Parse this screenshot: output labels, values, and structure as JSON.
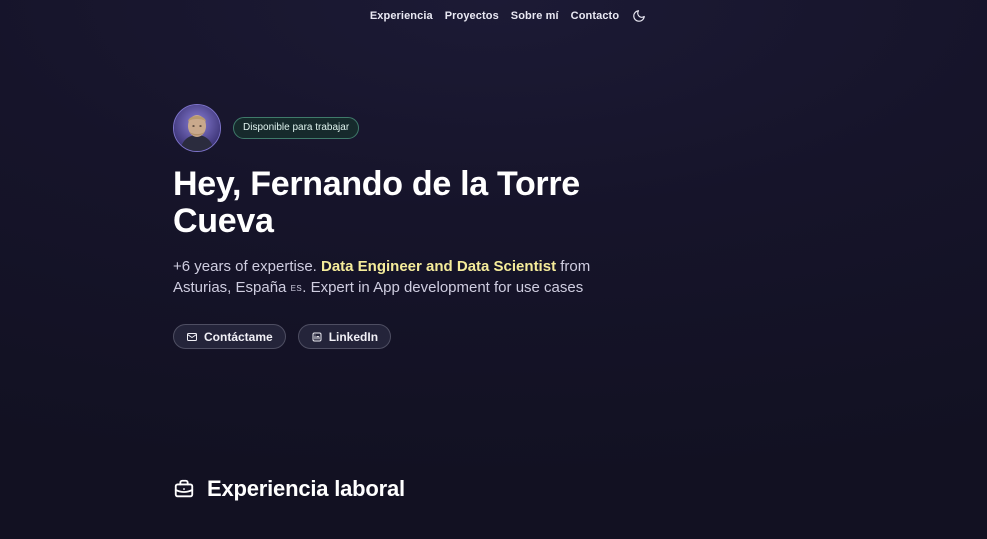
{
  "nav": {
    "items": [
      {
        "label": "Experiencia"
      },
      {
        "label": "Proyectos"
      },
      {
        "label": "Sobre mí"
      },
      {
        "label": "Contacto"
      }
    ],
    "theme_icon": "moon-icon"
  },
  "hero": {
    "avatar_icon": "profile-photo",
    "badge": "Disponible para trabajar",
    "title": "Hey, Fernando de la Torre Cueva",
    "desc_prefix": "+6 years of expertise. ",
    "desc_highlight": "Data Engineer and Data Scientist",
    "desc_middle": " from Asturias, España ",
    "desc_flag": "ES",
    "desc_suffix": ". Expert in App development for use cases",
    "buttons": [
      {
        "label": "Contáctame",
        "icon": "mail-icon"
      },
      {
        "label": "LinkedIn",
        "icon": "linkedin-icon"
      }
    ]
  },
  "section": {
    "title": "Experiencia laboral",
    "icon": "briefcase-icon"
  },
  "colors": {
    "background": "#16142a",
    "highlight": "#f5ec9a",
    "badge_border": "#3f7a6a"
  }
}
